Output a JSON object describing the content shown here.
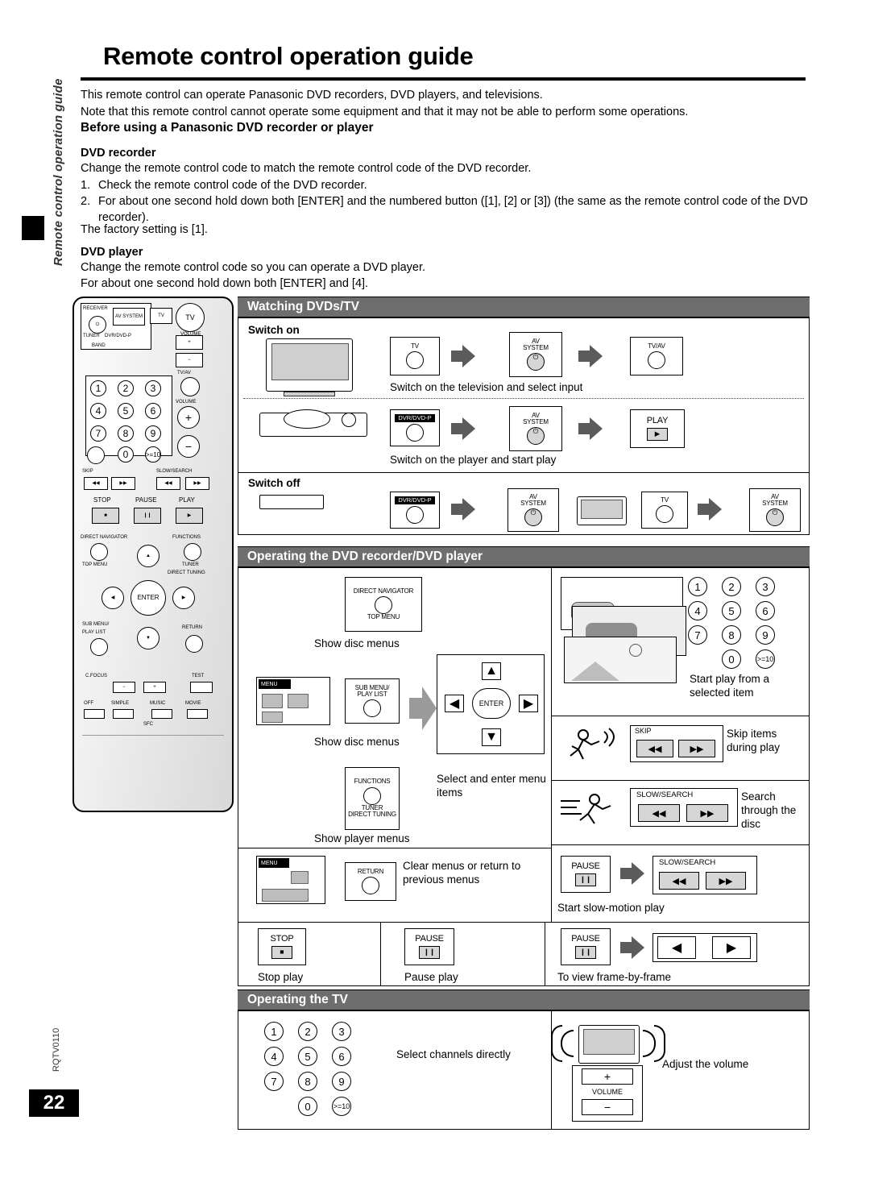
{
  "page": {
    "title": "Remote control operation guide",
    "number": "22",
    "doc_code": "RQTV0110",
    "side_label": "Remote control operation guide"
  },
  "intro": {
    "line1": "This remote control can operate Panasonic DVD recorders, DVD players, and televisions.",
    "line2": "Note that this remote control cannot operate some equipment and that it may not be able to perform some operations."
  },
  "before": {
    "heading": "Before using a Panasonic DVD recorder or player",
    "recorder_label": "DVD recorder",
    "recorder_text": "Change the remote control code to match the remote control code of the DVD recorder.",
    "steps": [
      {
        "n": "1.",
        "text": "Check the remote control code of the DVD recorder."
      },
      {
        "n": "2.",
        "text": "For about one second hold down both [ENTER] and the numbered button ([1], [2] or [3]) (the same as the remote control code of the DVD recorder)."
      }
    ],
    "factory": "The factory setting is [1].",
    "player_label": "DVD player",
    "player_text1": "Change the remote control code so you can operate a DVD player.",
    "player_text2": "For about one second hold down both [ENTER] and [4]."
  },
  "remote": {
    "buttons": {
      "receiver": "RECEIVER",
      "av_system": "AV SYSTEM",
      "tv": "TV",
      "tv_big": "TV",
      "tuner": "TUNER",
      "dvr_dvd_p": "DVR/DVD-P",
      "band": "BAND",
      "volume": "VOLUME",
      "tv_av": "TV/AV",
      "volume2": "VOLUME",
      "skip": "SKIP",
      "slow_search": "SLOW/SEARCH",
      "stop": "STOP",
      "pause": "PAUSE",
      "play": "PLAY",
      "direct_navigator": "DIRECT NAVIGATOR",
      "top_menu": "TOP MENU",
      "functions": "FUNCTIONS",
      "tuner_direct_tuning": "TUNER DIRECT TUNING",
      "enter": "ENTER",
      "sub_menu_play_list": "SUB MENU/ PLAY LIST",
      "return": "RETURN",
      "c_focus": "C.FOCUS",
      "test": "TEST",
      "off": "OFF",
      "simple": "SIMPLE",
      "music": "MUSIC",
      "movie": "MOVIE",
      "sfc": "SFC",
      "plus": "+",
      "minus": "−"
    },
    "keypad": [
      "1",
      "2",
      "3",
      "4",
      "5",
      "6",
      "7",
      "8",
      "9",
      "0",
      ">=10"
    ]
  },
  "watching": {
    "heading": "Watching DVDs/TV",
    "switch_on": "Switch on",
    "switch_off": "Switch off",
    "row1": {
      "keys": [
        "TV",
        "AV SYSTEM",
        "TV/AV"
      ],
      "caption": "Switch on the television and select input"
    },
    "row2": {
      "keys": [
        "DVR/DVD-P",
        "AV SYSTEM",
        "PLAY"
      ],
      "caption": "Switch on the player and start play"
    },
    "row3": {
      "keys": [
        "DVR/DVD-P",
        "AV SYSTEM",
        "TV",
        "AV SYSTEM"
      ]
    }
  },
  "operating_dvd": {
    "heading": "Operating the DVD recorder/DVD player",
    "items": [
      {
        "key": "DIRECT NAVIGATOR",
        "key2": "TOP MENU",
        "caption": "Show disc menus"
      },
      {
        "key": "SUB MENU/ PLAY LIST",
        "caption": "Show disc menus"
      },
      {
        "key": "FUNCTIONS",
        "key2": "TUNER DIRECT TUNING",
        "caption": "Show player menus"
      },
      {
        "key": "ENTER",
        "caption": "Select and enter menu items"
      },
      {
        "key": "RETURN",
        "caption": "Clear menus or return to  previous menus"
      },
      {
        "key": "STOP",
        "caption": "Stop play"
      },
      {
        "key": "PAUSE",
        "caption": "Pause play"
      },
      {
        "key": "PAUSE",
        "caption": "To view frame-by-frame"
      },
      {
        "key": "",
        "caption": "Start play from a selected item"
      },
      {
        "key": "SKIP",
        "caption": "Skip items during play"
      },
      {
        "key": "SLOW/SEARCH",
        "caption": "Search through the disc"
      },
      {
        "key": "PAUSE",
        "key2": "SLOW/SEARCH",
        "caption": "Start slow-motion play"
      }
    ],
    "menu_label": "MENU"
  },
  "operating_tv": {
    "heading": "Operating the TV",
    "channels_caption": "Select  channels directly",
    "volume_caption": "Adjust the volume",
    "volume_key": "VOLUME",
    "plus": "+",
    "minus": "−"
  }
}
